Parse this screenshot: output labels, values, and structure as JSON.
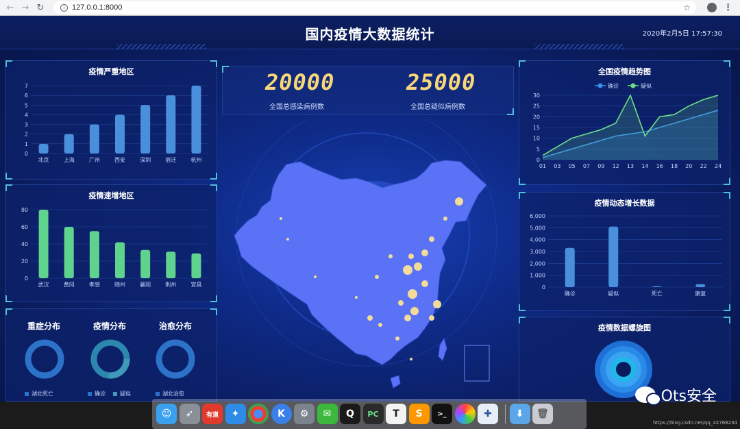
{
  "browser": {
    "url": "127.0.0.1:8000"
  },
  "header": {
    "title": "国内疫情大数据统计",
    "datetime": "2020年2月5日 17:57:30"
  },
  "stats": {
    "infected_value": "20000",
    "infected_label": "全国总感染病例数",
    "suspected_value": "25000",
    "suspected_label": "全国总疑似病例数"
  },
  "panels": {
    "severe_title": "疫情严重地区",
    "growth_title": "疫情速增地区",
    "trend_title": "全国疫情趋势图",
    "dynamic_title": "疫情动态增长数据",
    "spiral_title": "疫情数据螺旋图"
  },
  "donuts": [
    {
      "title": "重症分布",
      "legend": [
        "湖北死亡"
      ]
    },
    {
      "title": "疫情分布",
      "legend": [
        "确诊",
        "疑似"
      ]
    },
    {
      "title": "治愈分布",
      "legend": [
        "湖北治愈"
      ]
    }
  ],
  "colors": {
    "blue_bar": "#4a8fdc",
    "green_bar": "#5fd38e",
    "trend_blue": "#3a8fe8",
    "trend_green": "#6fe08a",
    "map_fill": "#5a72f5",
    "bubble": "#f3dc9a"
  },
  "chart_data": [
    {
      "type": "bar",
      "title": "疫情严重地区",
      "categories": [
        "北京",
        "上海",
        "广州",
        "西安",
        "深圳",
        "宿迁",
        "杭州"
      ],
      "values": [
        1,
        2,
        3,
        4,
        5,
        6,
        7
      ],
      "ylim": [
        0,
        7
      ],
      "yticks": [
        0,
        1,
        2,
        3,
        4,
        5,
        6,
        7
      ]
    },
    {
      "type": "bar",
      "title": "疫情速增地区",
      "categories": [
        "武汉",
        "黄冈",
        "孝感",
        "随州",
        "襄阳",
        "荆州",
        "宜昌"
      ],
      "values": [
        80,
        60,
        55,
        42,
        33,
        31,
        29
      ],
      "ylim": [
        0,
        80
      ],
      "yticks": [
        0,
        20,
        40,
        60,
        80
      ]
    },
    {
      "type": "line",
      "title": "全国疫情趋势图",
      "x": [
        "01",
        "03",
        "05",
        "07",
        "09",
        "12",
        "13",
        "14",
        "16",
        "18",
        "20",
        "22",
        "24"
      ],
      "ylim": [
        0,
        30
      ],
      "yticks": [
        0,
        5,
        10,
        15,
        20,
        25,
        30
      ],
      "series": [
        {
          "name": "确诊",
          "values": [
            1,
            3,
            5,
            7,
            9,
            11,
            12,
            13,
            15,
            17,
            19,
            21,
            23
          ]
        },
        {
          "name": "疑似",
          "values": [
            2,
            6,
            10,
            12,
            14,
            17,
            30,
            11,
            20,
            21,
            25,
            28,
            30
          ]
        }
      ],
      "legend": "top"
    },
    {
      "type": "bar",
      "title": "疫情动态增长数据",
      "categories": [
        "确诊",
        "疑似",
        "死亡",
        "康复"
      ],
      "values": [
        3300,
        5100,
        80,
        250
      ],
      "ylim": [
        0,
        6000
      ],
      "yticks": [
        "0",
        "1,000",
        "2,000",
        "3,000",
        "4,000",
        "5,000",
        "6,000"
      ]
    }
  ],
  "dock_apps": [
    "finder-icon",
    "launchpad-icon",
    "youdao-icon",
    "safari-icon",
    "chrome-icon",
    "kuaitu-icon",
    "sysprefs-icon",
    "wechat-icon",
    "qq-icon",
    "pycharm-icon",
    "typora-icon",
    "sublime-icon",
    "terminal-icon",
    "photos-icon",
    "tableau-icon",
    "downloads-icon",
    "trash-icon"
  ],
  "watermark": {
    "text": "Ots安全",
    "url": "https://blog.csdn.net/qq_42768234"
  }
}
